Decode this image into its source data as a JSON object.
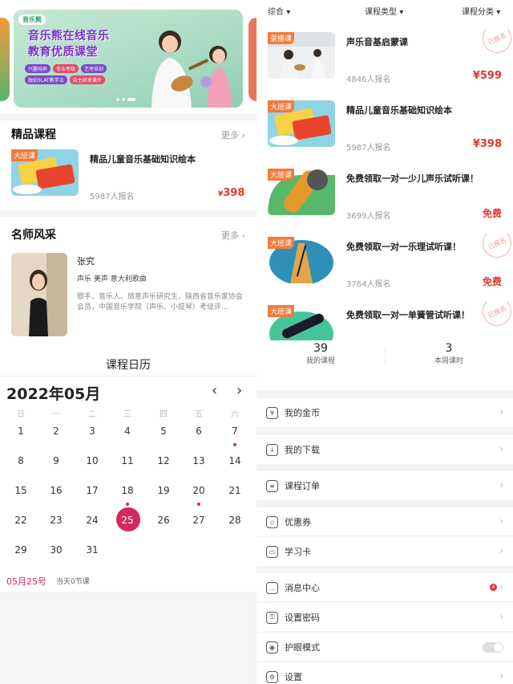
{
  "banner": {
    "logo": "音乐熊",
    "title_line1": "音乐熊在线音乐",
    "title_line2": "教育优质课堂",
    "tags": [
      "兴趣培养",
      "专业考级",
      "艺考培训",
      "独创3LAT教学法",
      "自主研发课件"
    ]
  },
  "featured": {
    "title": "精品课程",
    "more": "更多",
    "course": {
      "badge": "大班课",
      "title": "精品儿童音乐基础知识绘本",
      "enrolled": "5987人报名",
      "price_symbol": "¥",
      "price": "398"
    }
  },
  "teachers": {
    "title": "名师风采",
    "more": "更多",
    "teacher": {
      "name": "张究",
      "tags": "声乐 美声 意大利歌曲",
      "bio": "歌手、音乐人、旅意声乐研究生、陕西省音乐家协会会员，中国音乐学院（声乐、小提琴）考级评…"
    }
  },
  "calendar": {
    "title": "课程日历",
    "month": "2022年05月",
    "weekdays": [
      "日",
      "一",
      "二",
      "三",
      "四",
      "五",
      "六"
    ],
    "weeks": [
      [
        "1",
        "2",
        "3",
        "4",
        "5",
        "6",
        "7"
      ],
      [
        "8",
        "9",
        "10",
        "11",
        "12",
        "13",
        "14"
      ],
      [
        "15",
        "16",
        "17",
        "18",
        "19",
        "20",
        "21"
      ],
      [
        "22",
        "23",
        "24",
        "25",
        "26",
        "27",
        "28"
      ],
      [
        "29",
        "30",
        "31",
        "",
        "",
        "",
        ""
      ]
    ],
    "selected_date": "05月25号",
    "selected_info": "当天0节课"
  },
  "filters": [
    "综合",
    "课程类型",
    "课程分类"
  ],
  "courses": [
    {
      "badge": "录播课",
      "title": "声乐音基启蒙课",
      "enrolled": "4846人报名",
      "price": "¥599",
      "stamp": "已报名"
    },
    {
      "badge": "大班课",
      "title": "精品儿童音乐基础知识绘本",
      "enrolled": "5987人报名",
      "price": "¥398",
      "stamp": ""
    },
    {
      "badge": "大班课",
      "title": "免费领取一对一少儿声乐试听课！",
      "enrolled": "3699人报名",
      "price": "免费",
      "stamp": ""
    },
    {
      "badge": "大班课",
      "title": "免费领取一对一乐理试听课！",
      "enrolled": "3764人报名",
      "price": "免费",
      "stamp": "已报名"
    },
    {
      "badge": "大班课",
      "title": "免费领取一对一单簧管试听课！",
      "enrolled": "",
      "price": "",
      "stamp": "已报名"
    }
  ],
  "stats": [
    {
      "num": "39",
      "label": "我的课程"
    },
    {
      "num": "3",
      "label": "本周课时"
    }
  ],
  "menu": [
    {
      "label": "我的金币",
      "icon": "coin-icon",
      "glyph": "¥"
    },
    {
      "label": "我的下载",
      "icon": "download-icon",
      "glyph": "↓"
    },
    {
      "label": "课程订单",
      "icon": "order-icon",
      "glyph": "≡"
    },
    {
      "label": "优惠券",
      "icon": "coupon-icon",
      "glyph": "◇"
    },
    {
      "label": "学习卡",
      "icon": "card-icon",
      "glyph": "▭"
    },
    {
      "label": "消息中心",
      "icon": "message-icon",
      "glyph": "…",
      "badge": "4"
    },
    {
      "label": "设置密码",
      "icon": "lock-icon",
      "glyph": "⚿"
    },
    {
      "label": "护眼模式",
      "icon": "eye-icon",
      "glyph": "◉"
    },
    {
      "label": "设置",
      "icon": "settings-icon",
      "glyph": "⚙"
    }
  ]
}
